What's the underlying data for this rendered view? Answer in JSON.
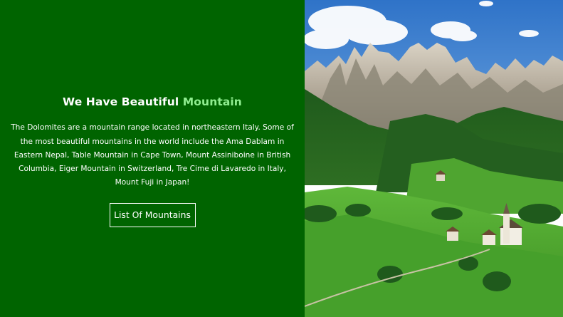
{
  "hero": {
    "heading_prefix": "We Have Beautiful ",
    "heading_accent": "Mountain",
    "description": "The Dolomites are a mountain range located in northeastern Italy. Some of the most beautiful mountains in the world include the Ama Dablam in Eastern Nepal, Table Mountain in Cape Town, Mount Assiniboine in British Columbia, Eiger Mountain in Switzerland, Tre Cime di Lavaredo in Italy, Mount Fuji in Japan!",
    "button_label": "List Of Mountains"
  },
  "colors": {
    "panel_background": "#006400",
    "accent": "#90ee90",
    "text": "#ffffff"
  }
}
